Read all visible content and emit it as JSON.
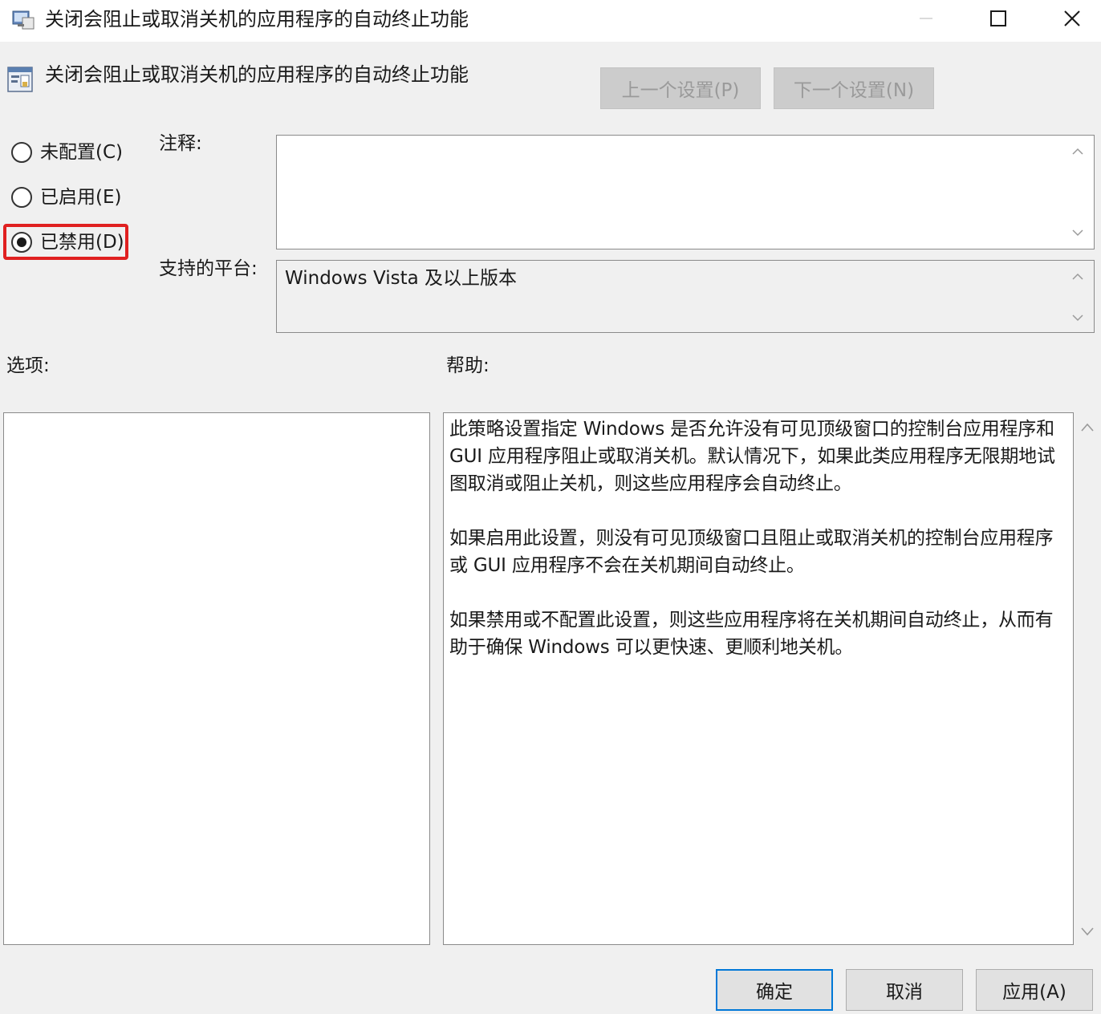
{
  "window": {
    "title": "关闭会阻止或取消关机的应用程序的自动终止功能"
  },
  "header": {
    "policy_title": "关闭会阻止或取消关机的应用程序的自动终止功能",
    "prev_label": "上一个设置(P)",
    "next_label": "下一个设置(N)"
  },
  "state": {
    "options": [
      {
        "label": "未配置(C)",
        "checked": false
      },
      {
        "label": "已启用(E)",
        "checked": false
      },
      {
        "label": "已禁用(D)",
        "checked": true
      }
    ]
  },
  "comment": {
    "label": "注释:",
    "value": ""
  },
  "platform": {
    "label": "支持的平台:",
    "value": "Windows Vista 及以上版本"
  },
  "options_panel": {
    "label": "选项:"
  },
  "help_panel": {
    "label": "帮助:",
    "paragraphs": [
      "此策略设置指定 Windows 是否允许没有可见顶级窗口的控制台应用程序和 GUI 应用程序阻止或取消关机。默认情况下，如果此类应用程序无限期地试图取消或阻止关机，则这些应用程序会自动终止。",
      "如果启用此设置，则没有可见顶级窗口且阻止或取消关机的控制台应用程序或 GUI 应用程序不会在关机期间自动终止。",
      "如果禁用或不配置此设置，则这些应用程序将在关机期间自动终止，从而有助于确保 Windows 可以更快速、更顺利地关机。"
    ]
  },
  "footer": {
    "ok_label": "确定",
    "cancel_label": "取消",
    "apply_label": "应用(A)"
  },
  "colors": {
    "highlight": "#e02020",
    "focus_border": "#0078d7"
  }
}
